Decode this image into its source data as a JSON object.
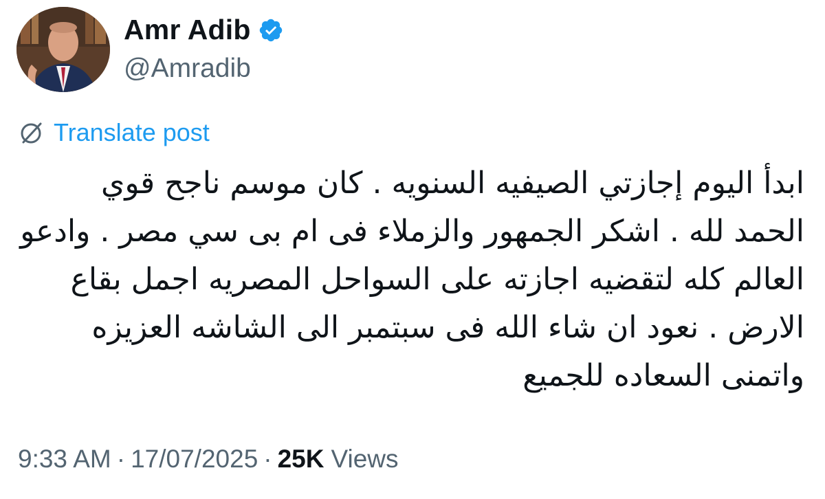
{
  "author": {
    "display_name": "Amr Adib",
    "handle": "@Amradib",
    "verified": true
  },
  "translate": {
    "label": "Translate post",
    "icon": "globe-slash-icon"
  },
  "post": {
    "lines": [
      "ابدأ اليوم إجازتي الصيفيه السنويه . كان موسم ناجح قوي",
      "الحمد لله . اشكر الجمهور والزملاء فى ام بى سي مصر . وادعو",
      "العالم كله لتقضيه اجازته على السواحل المصريه اجمل بقاع",
      "الارض . نعود ان شاء الله فى سبتمبر الى الشاشه العزيزه",
      "واتمنى السعاده للجميع"
    ]
  },
  "meta": {
    "time": "9:33 AM",
    "separator": "·",
    "date": "17/07/2025",
    "views_count": "25K",
    "views_label": "Views"
  },
  "colors": {
    "accent": "#1d9bf0",
    "text": "#0f1419",
    "secondary": "#536471",
    "verified_badge": "#1d9bf0"
  }
}
